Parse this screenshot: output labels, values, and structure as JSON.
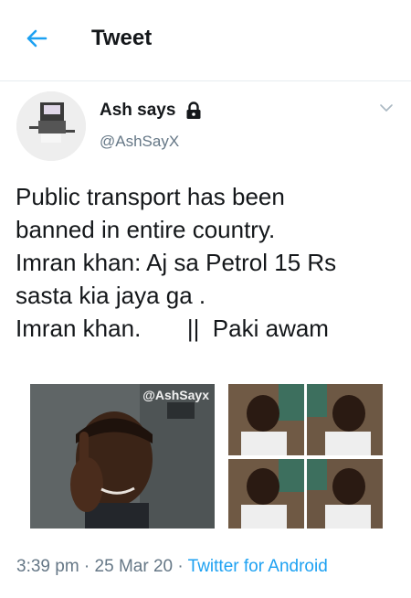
{
  "header": {
    "title": "Tweet"
  },
  "tweet": {
    "author_name": "Ash says",
    "handle": "@AshSayX",
    "text_lines": [
      "Public transport has been",
      "banned in entire country.",
      "Imran khan: Aj sa Petrol 15 Rs",
      "sasta kia jaya ga .",
      "Imran khan.       ||  Paki awam"
    ],
    "media_watermark": "@AshSayx",
    "time": "3:39 pm",
    "date": "25 Mar 20",
    "separator": " · ",
    "source": "Twitter for Android"
  },
  "colors": {
    "accent": "#1da1f2",
    "muted": "#657786",
    "text": "#14171a"
  },
  "icons": [
    "back-arrow-icon",
    "lock-icon",
    "chevron-down-icon"
  ]
}
